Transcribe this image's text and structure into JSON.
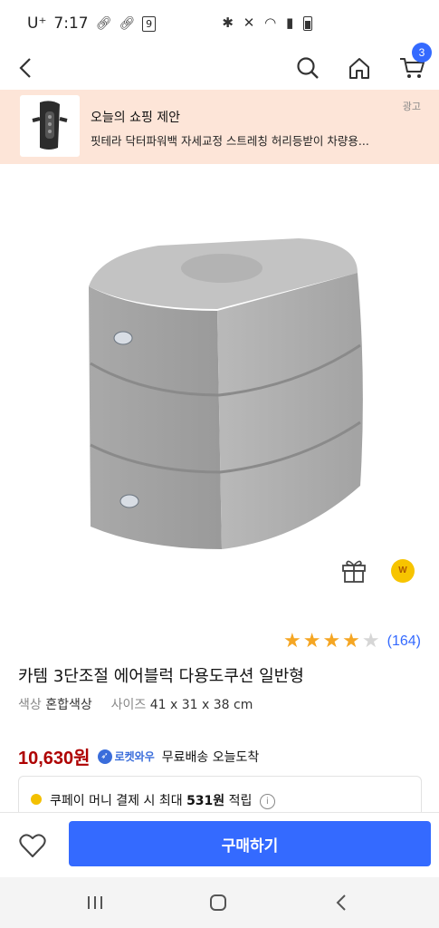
{
  "status_bar": {
    "carrier": "U⁺",
    "time": "7:17",
    "notification_badge": "9",
    "icons": [
      "bluetooth-icon",
      "mute-icon",
      "wifi-icon",
      "signal-icon",
      "battery-icon"
    ]
  },
  "header": {
    "icons": [
      "back-icon",
      "search-icon",
      "home-icon",
      "cart-icon"
    ],
    "cart_count": "3"
  },
  "ad_banner": {
    "title": "오늘의 쇼핑 제안",
    "description": "핏테라 닥터파워백 자세교정 스트레칭 허리등받이 차량용...",
    "tag": "광고"
  },
  "product": {
    "rating": 4,
    "review_count": "(164)",
    "title": "카템 3단조절 에어블럭 다용도쿠션 일반형",
    "color_label": "색상",
    "color_value": "혼합색상",
    "size_label": "사이즈",
    "size_value": "41 x 31 x 38 cm",
    "price": "10,630원",
    "rocket_label": "로켓와우",
    "shipping": "무료배송 오늘도착",
    "coin_label": "W"
  },
  "coupay": {
    "prefix": "쿠페이 머니 결제 시 최대 ",
    "amount": "531원",
    "suffix": " 적립"
  },
  "action_bar": {
    "buy_label": "구매하기"
  },
  "colors": {
    "accent": "#346aff",
    "price": "#ae0000",
    "ad_bg": "#fde5d8",
    "star": "#f5a623"
  }
}
